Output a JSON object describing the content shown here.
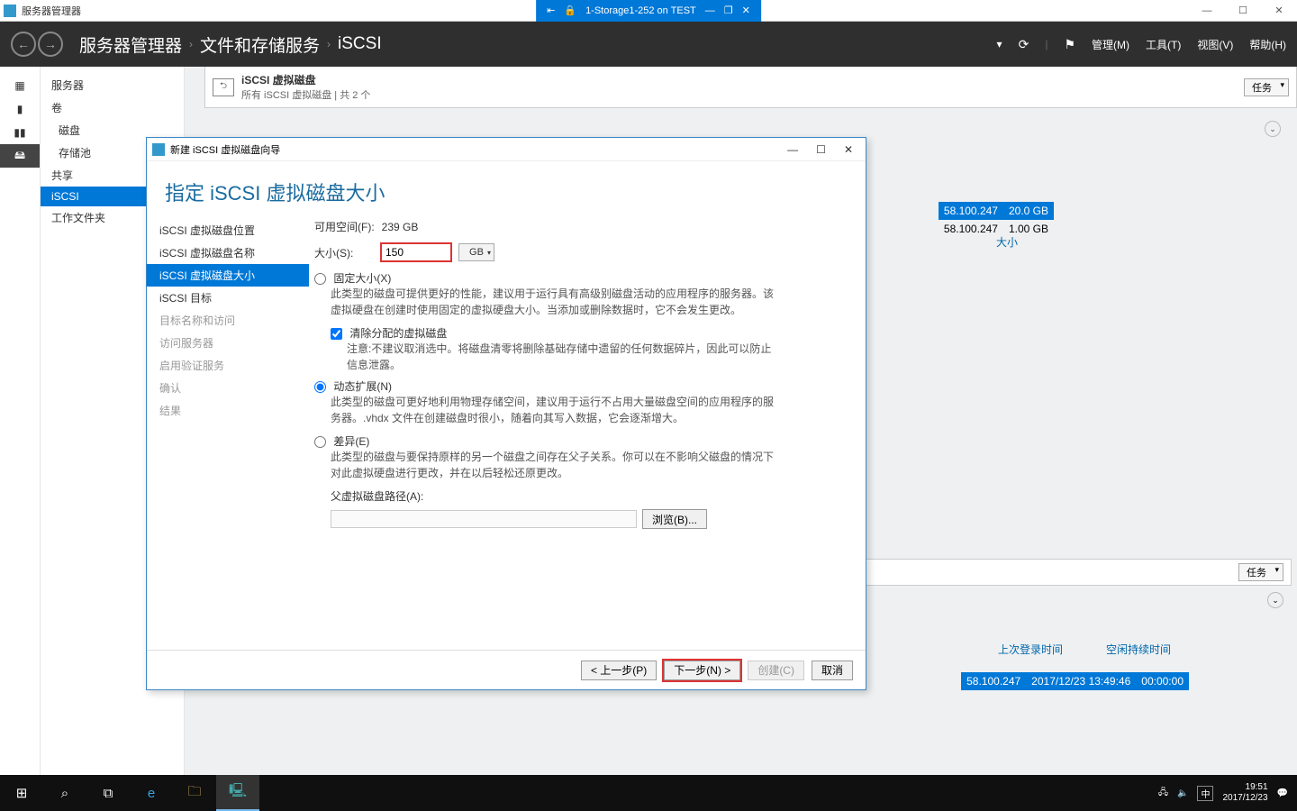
{
  "outer": {
    "app_title": "服务器管理器",
    "vm_title": "1-Storage1-252 on TEST"
  },
  "header": {
    "bc1": "服务器管理器",
    "bc2": "文件和存储服务",
    "bc3": "iSCSI",
    "menu": {
      "manage": "管理(M)",
      "tools": "工具(T)",
      "view": "视图(V)",
      "help": "帮助(H)"
    }
  },
  "nav": {
    "servers": "服务器",
    "volumes": "卷",
    "disks": "磁盘",
    "pools": "存储池",
    "shares": "共享",
    "iscsi": "iSCSI",
    "workfolders": "工作文件夹"
  },
  "content_head": {
    "title": "iSCSI 虚拟磁盘",
    "subtitle": "所有 iSCSI 虚拟磁盘 | 共 2 个",
    "tasks": "任务"
  },
  "bg_table": {
    "col_size": "大小",
    "rows": [
      {
        "ip": "58.100.247",
        "size": "20.0 GB"
      },
      {
        "ip": "58.100.247",
        "size": "1.00 GB"
      }
    ]
  },
  "lower_table": {
    "col_login": "上次登录时间",
    "col_idle": "空闲持续时间",
    "row": {
      "ip": "58.100.247",
      "login": "2017/12/23 13:49:46",
      "idle": "00:00:00"
    }
  },
  "wizard": {
    "title": "新建 iSCSI 虚拟磁盘向导",
    "heading": "指定 iSCSI 虚拟磁盘大小",
    "steps": {
      "loc": "iSCSI 虚拟磁盘位置",
      "name": "iSCSI 虚拟磁盘名称",
      "size": "iSCSI 虚拟磁盘大小",
      "target": "iSCSI 目标",
      "tgtname": "目标名称和访问",
      "access": "访问服务器",
      "auth": "启用验证服务",
      "confirm": "确认",
      "result": "结果"
    },
    "avail_label": "可用空间(F):",
    "avail_value": "239 GB",
    "size_label": "大小(S):",
    "size_value": "150",
    "size_unit": "GB",
    "fixed": {
      "label": "固定大小(X)",
      "desc": "此类型的磁盘可提供更好的性能，建议用于运行具有高级别磁盘活动的应用程序的服务器。该虚拟硬盘在创建时使用固定的虚拟硬盘大小。当添加或删除数据时，它不会发生更改。",
      "clear_label": "清除分配的虚拟磁盘",
      "clear_desc": "注意:不建议取消选中。将磁盘清零将删除基础存储中遗留的任何数据碎片，因此可以防止信息泄露。"
    },
    "dynamic": {
      "label": "动态扩展(N)",
      "desc": "此类型的磁盘可更好地利用物理存储空间，建议用于运行不占用大量磁盘空间的应用程序的服务器。.vhdx 文件在创建磁盘时很小，随着向其写入数据，它会逐渐增大。"
    },
    "diff": {
      "label": "差异(E)",
      "desc": "此类型的磁盘与要保持原样的另一个磁盘之间存在父子关系。你可以在不影响父磁盘的情况下对此虚拟硬盘进行更改，并在以后轻松还原更改。",
      "parent_label": "父虚拟磁盘路径(A):",
      "browse": "浏览(B)..."
    },
    "buttons": {
      "prev": "< 上一步(P)",
      "next": "下一步(N) >",
      "create": "创建(C)",
      "cancel": "取消"
    }
  },
  "taskbar": {
    "ime": "中",
    "time": "19:51",
    "date": "2017/12/23"
  }
}
